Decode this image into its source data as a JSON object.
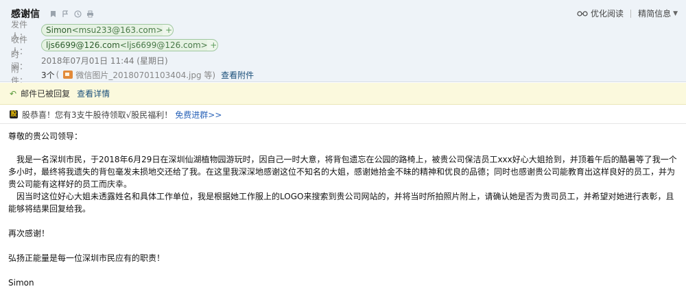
{
  "header": {
    "subject": "感谢信",
    "tools": {
      "read_mode": "优化阅读",
      "detail": "精简信息"
    },
    "sender": {
      "label": "发件人：",
      "name": "Simon",
      "email": "<msu233@163.com>"
    },
    "recipient": {
      "label": "收件人：",
      "name": "ljs6699@126.com",
      "email": "<ljs6699@126.com>"
    },
    "time": {
      "label": "时　间：",
      "value": "2018年07月01日 11:44 (星期日)"
    },
    "attachments": {
      "label": "附　件：",
      "count": "3个",
      "open_paren": "(",
      "file": "微信图片_20180701103404.jpg 等)",
      "view": "查看附件"
    }
  },
  "reply_bar": {
    "status": "邮件已被回复",
    "detail": "查看详情"
  },
  "promo": {
    "icon_text": "股",
    "text": "股恭喜！您有3支牛股待领取√股民福利！",
    "link": "免费进群>>"
  },
  "body": {
    "greeting": "尊敬的贵公司领导：",
    "para1": "　我是一名深圳市民，于2018年6月29日在深圳仙湖植物园游玩时，因自己一时大意，将背包遗忘在公园的路椅上，被贵公司保洁员工xxx好心大姐拾到，并顶着午后的酷暑等了我一个多小时，最终将我遗失的背包毫发未损地交还给了我。在这里我深深地感谢这位不知名的大姐，感谢她拾金不昧的精神和优良的品德；同时也感谢贵公司能教育出这样良好的员工，并为贵公司能有这样好的员工而庆幸。",
    "para2": "　因当时这位好心大姐未透露姓名和具体工作单位，我是根据她工作服上的LOGO来搜索到贵公司网站的，并将当时所拍照片附上，请确认她是否为贵司员工，并希望对她进行表彰，且能够将结果回复给我。",
    "thanks": "再次感谢！",
    "motto": "弘扬正能量是每一位深圳市民应有的职责！",
    "signature": "Simon"
  }
}
